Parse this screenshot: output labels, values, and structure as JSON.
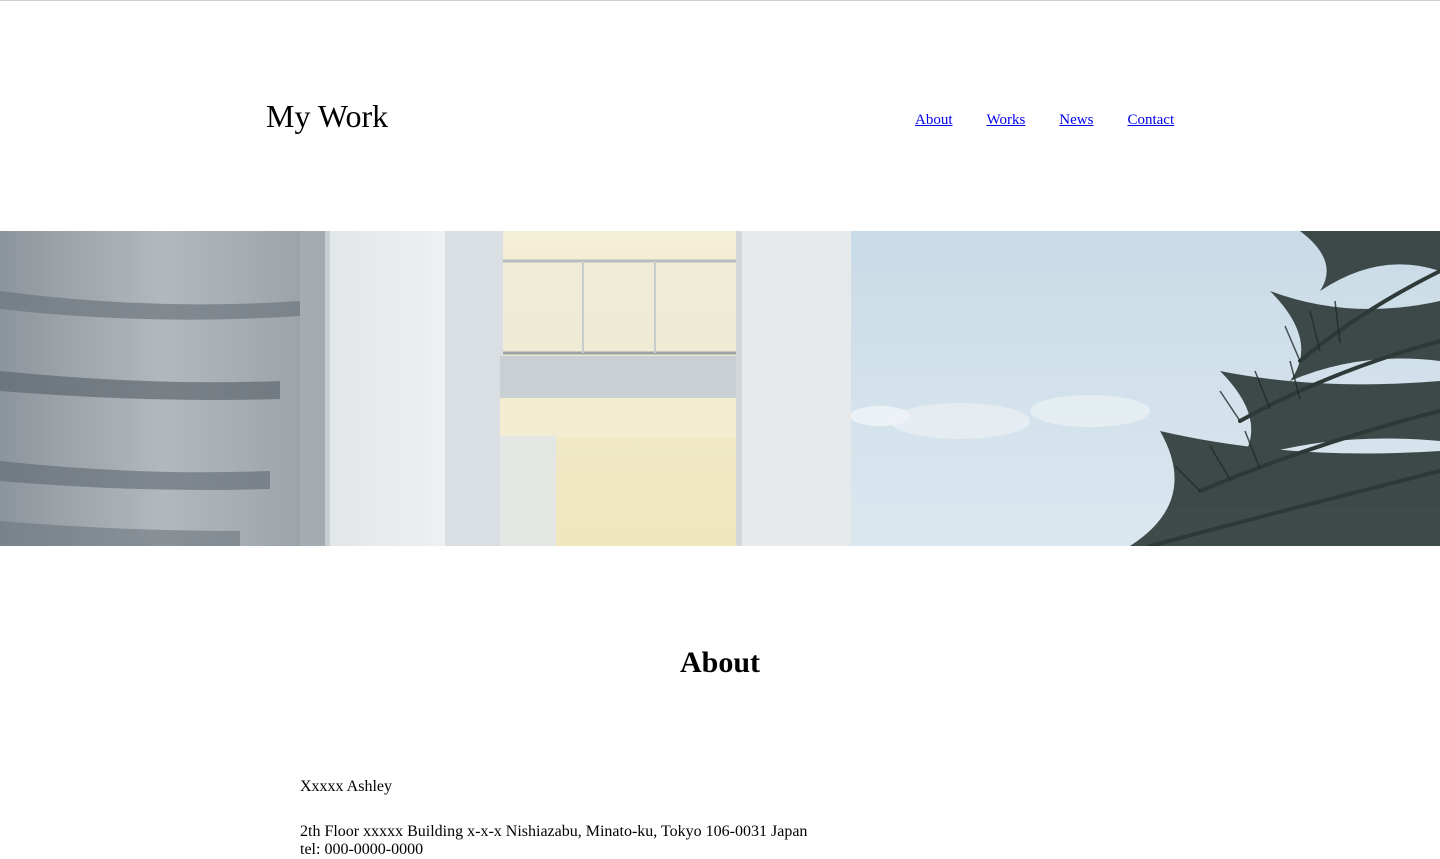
{
  "header": {
    "site_title": "My Work",
    "nav": [
      {
        "label": "About"
      },
      {
        "label": "Works"
      },
      {
        "label": "News"
      },
      {
        "label": "Contact"
      }
    ]
  },
  "hero": {
    "image": "white-building-with-palm-trees"
  },
  "about": {
    "heading": "About",
    "name": "Xxxxx Ashley",
    "address": "2th Floor xxxxx Building x-x-x Nishiazabu, Minato-ku, Tokyo 106-0031 Japan",
    "tel": "tel: 000-0000-0000"
  },
  "colors": {
    "link": "#0000ee",
    "text": "#000000",
    "background": "#ffffff",
    "sky": "#d3e2ec",
    "building": "#e9ecec",
    "warm_light": "#f3ecc8"
  }
}
